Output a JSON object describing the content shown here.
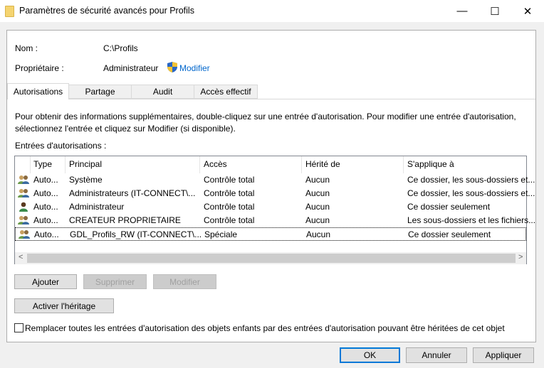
{
  "window": {
    "title": "Paramètres de sécurité avancés pour Profils"
  },
  "info": {
    "name_label": "Nom :",
    "name_value": "C:\\Profils",
    "owner_label": "Propriétaire :",
    "owner_value": "Administrateur",
    "change_link": "Modifier"
  },
  "tabs": [
    "Autorisations",
    "Partage",
    "Audit",
    "Accès effectif"
  ],
  "description": "Pour obtenir des informations supplémentaires, double-cliquez sur une entrée d'autorisation. Pour modifier une entrée d'autorisation, sélectionnez l'entrée et cliquez sur Modifier (si disponible).",
  "entries_label": "Entrées d'autorisations :",
  "columns": [
    "Type",
    "Principal",
    "Accès",
    "Hérité de",
    "S'applique à"
  ],
  "rows": [
    {
      "icon": "group",
      "type": "Auto...",
      "principal": "Système",
      "access": "Contrôle total",
      "inherited": "Aucun",
      "applies": "Ce dossier, les sous-dossiers et..."
    },
    {
      "icon": "group",
      "type": "Auto...",
      "principal": "Administrateurs (IT-CONNECT\\...",
      "access": "Contrôle total",
      "inherited": "Aucun",
      "applies": "Ce dossier, les sous-dossiers et..."
    },
    {
      "icon": "user",
      "type": "Auto...",
      "principal": "Administrateur",
      "access": "Contrôle total",
      "inherited": "Aucun",
      "applies": "Ce dossier seulement"
    },
    {
      "icon": "group",
      "type": "Auto...",
      "principal": "CREATEUR PROPRIETAIRE",
      "access": "Contrôle total",
      "inherited": "Aucun",
      "applies": "Les sous-dossiers et les fichiers..."
    },
    {
      "icon": "group",
      "type": "Auto...",
      "principal": "GDL_Profils_RW (IT-CONNECT\\...",
      "access": "Spéciale",
      "inherited": "Aucun",
      "applies": "Ce dossier seulement"
    }
  ],
  "buttons": {
    "add": "Ajouter",
    "remove": "Supprimer",
    "edit": "Modifier",
    "inherit": "Activer l'héritage",
    "ok": "OK",
    "cancel": "Annuler",
    "apply": "Appliquer"
  },
  "replace_checkbox": {
    "label": "Remplacer toutes les entrées d'autorisation des objets enfants par des entrées d'autorisation pouvant être héritées de cet objet",
    "checked": false
  }
}
